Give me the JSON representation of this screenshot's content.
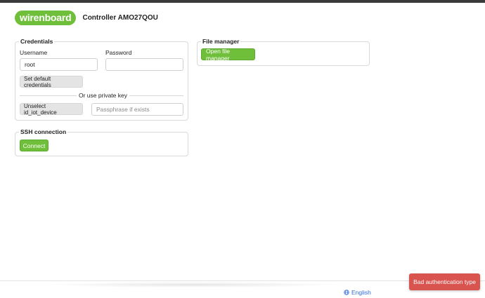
{
  "header": {
    "logo_text": "wirenboard",
    "controller_title": "Controller AMO27QOU"
  },
  "credentials": {
    "legend": "Credentials",
    "username_label": "Username",
    "username_value": "root",
    "password_label": "Password",
    "password_value": "",
    "set_default_label": "Set default credentials",
    "divider_text": "Or use private key",
    "unselect_key_label": "Unselect id_iot_device",
    "passphrase_placeholder": "Passphrase if exists"
  },
  "ssh": {
    "legend": "SSH connection",
    "connect_label": "Connect"
  },
  "file_manager": {
    "legend": "File manager",
    "open_label": "Open file manager"
  },
  "footer": {
    "language_label": "English",
    "language_icon": "globe-icon"
  },
  "toast": {
    "message": "Bad authentication type"
  },
  "colors": {
    "brand_green": "#6fbf3a",
    "error_red": "#d9534f",
    "link_blue": "#2f6bd8",
    "topbar": "#3a3a3a"
  }
}
